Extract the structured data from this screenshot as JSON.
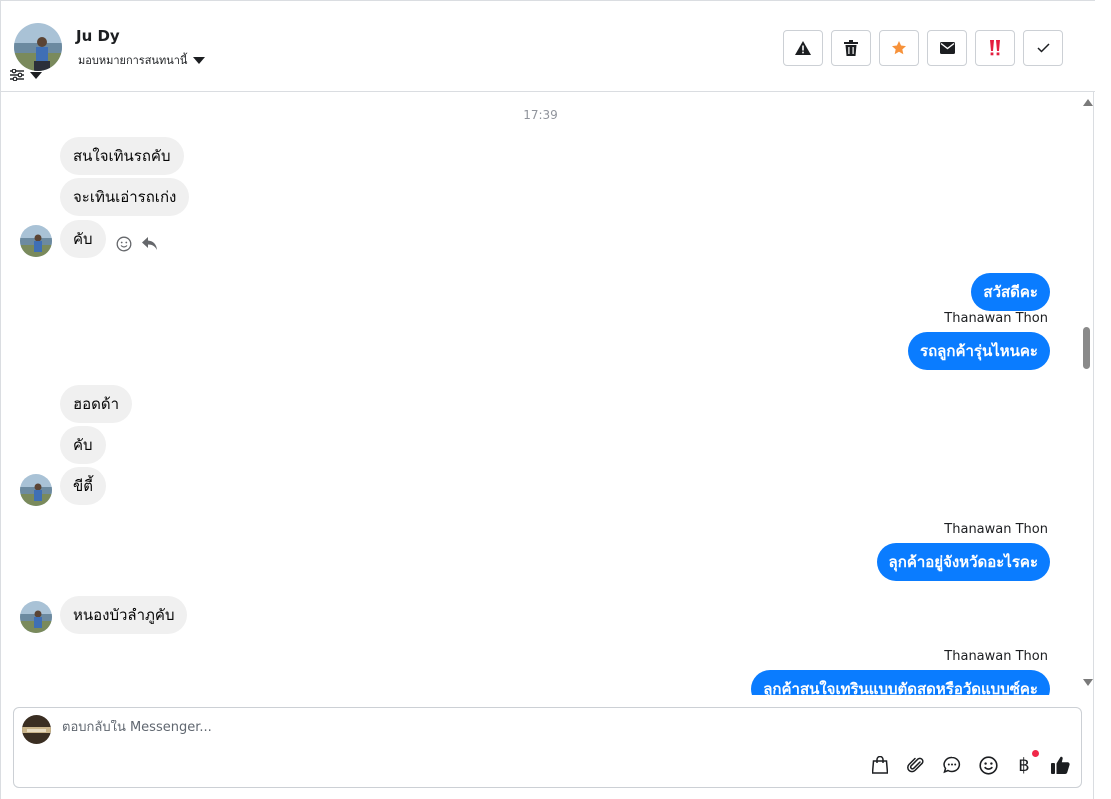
{
  "header": {
    "contact_name": "Ju Dy",
    "assign_label": "มอบหมายการสนทนานี้"
  },
  "actions": [
    {
      "name": "report-spam-button",
      "icon": "warning-icon"
    },
    {
      "name": "delete-button",
      "icon": "trash-icon"
    },
    {
      "name": "star-button",
      "icon": "star-icon"
    },
    {
      "name": "mark-unread-button",
      "icon": "envelope-icon"
    },
    {
      "name": "follow-up-button",
      "icon": "double-exclamation-icon"
    },
    {
      "name": "mark-done-button",
      "icon": "check-icon"
    }
  ],
  "thread": {
    "timestamp": "17:39",
    "incoming_1": [
      "สนใจเทินรถคับ",
      "จะเทินเอ่ารถเก่ง",
      "คับ"
    ],
    "outgoing_1": "สวัสดีคะ",
    "outgoing_2": {
      "sender": "Thanawan Thon",
      "text": "รถลูกค้ารุ่นไหนคะ"
    },
    "incoming_2": [
      "ฮอดด้า",
      "คับ",
      "ขีตี้"
    ],
    "outgoing_3": {
      "sender": "Thanawan Thon",
      "text": "ลุกค้าอยู่จังหวัดอะไรคะ"
    },
    "incoming_3": [
      "หนองบัวลำภูคับ"
    ],
    "outgoing_4": {
      "sender": "Thanawan Thon",
      "text": "ลูกค้าสนใจเทรินแบบตัดสดหรือวัดแบบซ์คะ"
    }
  },
  "composer": {
    "placeholder": "ตอบกลับใน Messenger...",
    "baht_symbol": "฿"
  },
  "colors": {
    "accent": "#0a7cff",
    "bubble_in": "#f0f0f0",
    "star": "#f7923a",
    "follow_up": "#e41e3f"
  }
}
